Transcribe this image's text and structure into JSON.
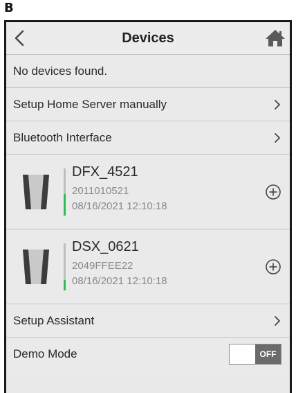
{
  "panel_letter": "B",
  "header": {
    "title": "Devices"
  },
  "rows": {
    "no_devices": "No devices found.",
    "setup_home_server": "Setup Home Server manually",
    "bluetooth": "Bluetooth Interface",
    "setup_assistant": "Setup Assistant",
    "demo_mode": "Demo Mode"
  },
  "devices": [
    {
      "name": "DFX_4521",
      "id": "2011010521",
      "timestamp": "08/16/2021 12:10:18",
      "signal_level": 0.45
    },
    {
      "name": "DSX_0621",
      "id": "2049FFEE22",
      "timestamp": "08/16/2021 12:10:18",
      "signal_level": 0.22
    }
  ],
  "demo_toggle": {
    "state": "OFF"
  },
  "colors": {
    "accent_green": "#2ebd4f",
    "toggle_dark": "#6b6b6b",
    "background": "#eaeaea"
  },
  "icons": [
    "back-icon",
    "home-icon",
    "chevron-right-icon",
    "device-icon",
    "add-circle-icon"
  ]
}
